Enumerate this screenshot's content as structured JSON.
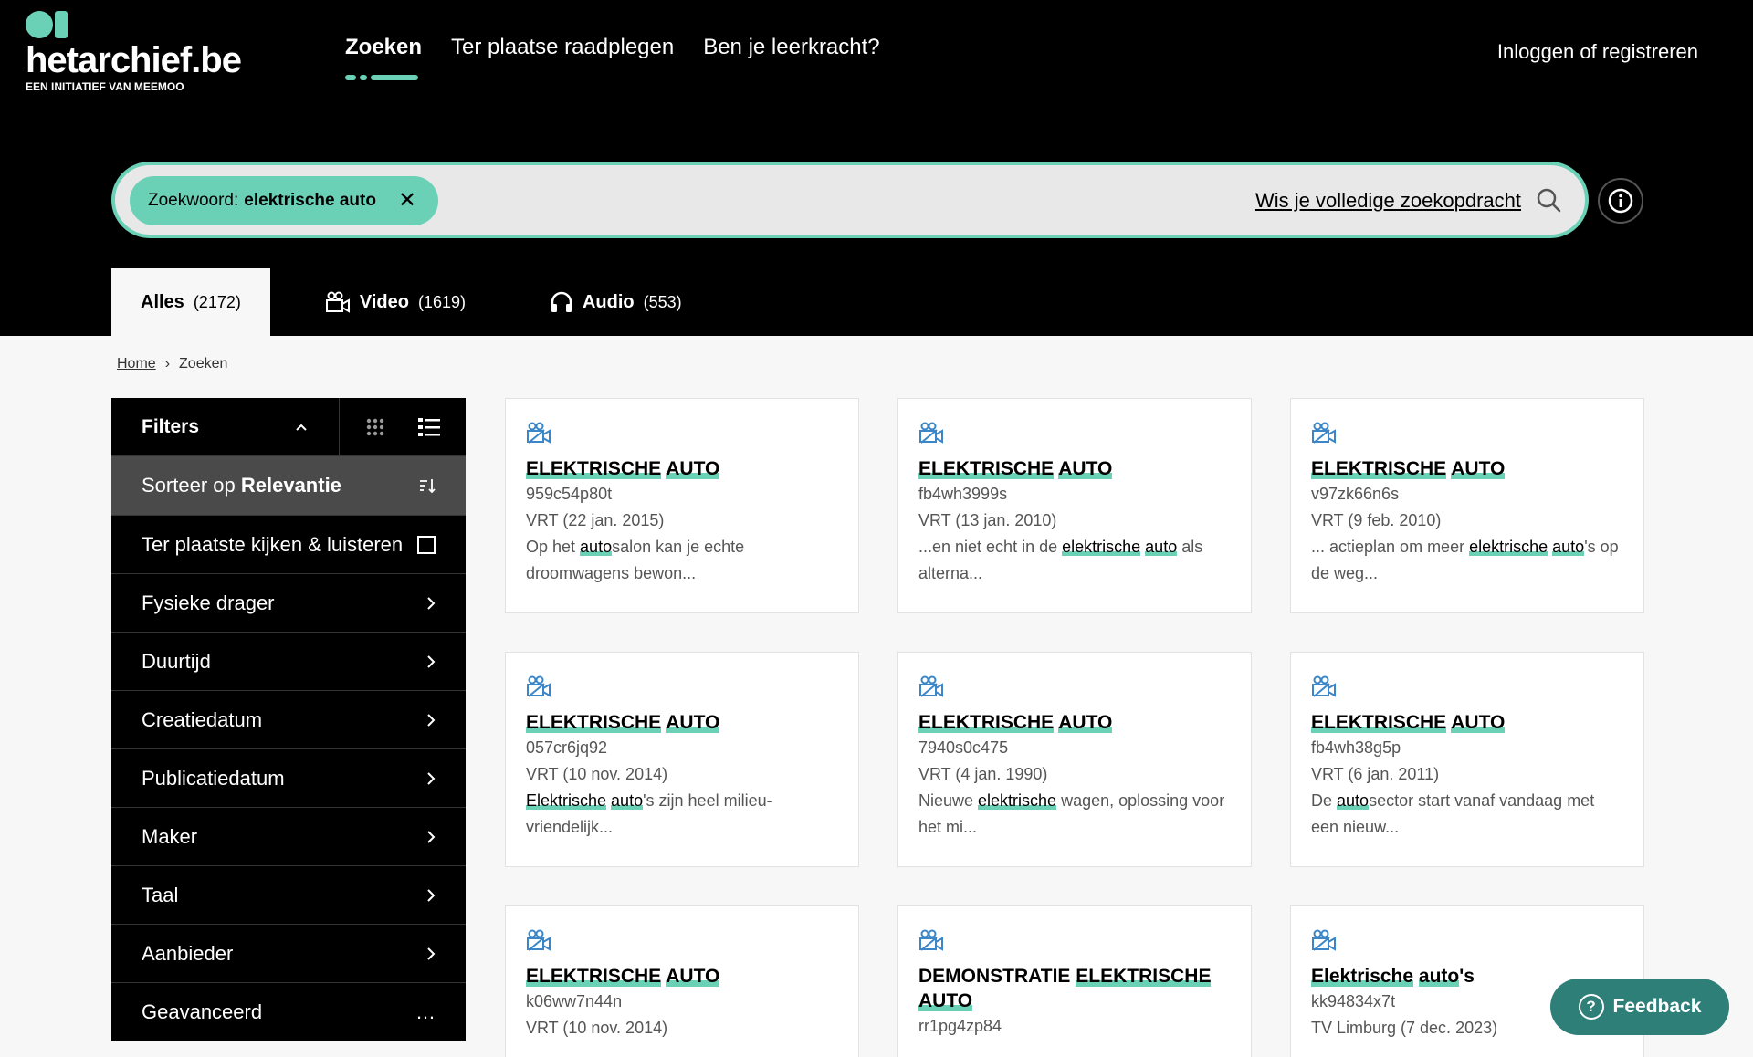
{
  "brand": {
    "wordmark": "hetarchief.be",
    "tagline": "EEN INITIATIEF VAN MEEMOO",
    "accent": "#6ad0b6"
  },
  "nav": {
    "items": [
      "Zoeken",
      "Ter plaatse raadplegen",
      "Ben je leerkracht?"
    ],
    "login": "Inloggen of registreren"
  },
  "search": {
    "chip_label": "Zoekwoord:",
    "chip_value": "elektrische auto",
    "clear": "Wis je volledige zoekopdracht",
    "icons": {
      "search": "search-icon",
      "info": "info-icon",
      "remove": "close-icon"
    }
  },
  "tabs": [
    {
      "label": "Alles",
      "count": "(2172)",
      "icon": ""
    },
    {
      "label": "Video",
      "count": "(1619)",
      "icon": "video-camera-icon"
    },
    {
      "label": "Audio",
      "count": "(553)",
      "icon": "headphones-icon"
    }
  ],
  "breadcrumb": {
    "home": "Home",
    "current": "Zoeken"
  },
  "sidebar": {
    "filters": "Filters",
    "sort_prefix": "Sorteer op",
    "sort_value": "Relevantie",
    "onsite": "Ter plaatste kijken & luisteren",
    "items": [
      "Fysieke drager",
      "Duurtijd",
      "Creatiedatum",
      "Publicatiedatum",
      "Maker",
      "Taal",
      "Aanbieder"
    ],
    "advanced": "Geavanceerd",
    "advanced_icon": "…"
  },
  "cards": [
    {
      "title": [
        [
          "ELEKTRISCHE",
          true
        ],
        [
          " ",
          false
        ],
        [
          "AUTO",
          true
        ]
      ],
      "id": "959c54p80t",
      "meta": "VRT (22 jan. 2015)",
      "desc": [
        [
          "Op het ",
          false
        ],
        [
          "auto",
          true
        ],
        [
          "salon kan je echte droomwagens bewon...",
          false
        ]
      ]
    },
    {
      "title": [
        [
          "ELEKTRISCHE",
          true
        ],
        [
          " ",
          false
        ],
        [
          "AUTO",
          true
        ]
      ],
      "id": "fb4wh3999s",
      "meta": "VRT (13 jan. 2010)",
      "desc": [
        [
          "...en niet echt in de ",
          false
        ],
        [
          "elektrische",
          true
        ],
        [
          " ",
          false
        ],
        [
          "auto",
          true
        ],
        [
          " als alterna...",
          false
        ]
      ]
    },
    {
      "title": [
        [
          "ELEKTRISCHE",
          true
        ],
        [
          " ",
          false
        ],
        [
          "AUTO",
          true
        ]
      ],
      "id": "v97zk66n6s",
      "meta": "VRT (9 feb. 2010)",
      "desc": [
        [
          "... actieplan om meer ",
          false
        ],
        [
          "elektrische",
          true
        ],
        [
          " ",
          false
        ],
        [
          "auto",
          true
        ],
        [
          "'s op de weg...",
          false
        ]
      ]
    },
    {
      "title": [
        [
          "ELEKTRISCHE",
          true
        ],
        [
          " ",
          false
        ],
        [
          "AUTO",
          true
        ]
      ],
      "id": "057cr6jq92",
      "meta": "VRT (10 nov. 2014)",
      "desc": [
        [
          "Elektrische",
          true
        ],
        [
          " ",
          false
        ],
        [
          "auto",
          true
        ],
        [
          "'s zijn heel milieu-vriendelijk...",
          false
        ]
      ]
    },
    {
      "title": [
        [
          "ELEKTRISCHE",
          true
        ],
        [
          " ",
          false
        ],
        [
          "AUTO",
          true
        ]
      ],
      "id": "7940s0c475",
      "meta": "VRT (4 jan. 1990)",
      "desc": [
        [
          "Nieuwe ",
          false
        ],
        [
          "elektrische",
          true
        ],
        [
          " wagen, oplossing voor het mi...",
          false
        ]
      ]
    },
    {
      "title": [
        [
          "ELEKTRISCHE",
          true
        ],
        [
          " ",
          false
        ],
        [
          "AUTO",
          true
        ]
      ],
      "id": "fb4wh38g5p",
      "meta": "VRT (6 jan. 2011)",
      "desc": [
        [
          "De ",
          false
        ],
        [
          "auto",
          true
        ],
        [
          "sector start vanaf vandaag met een nieuw...",
          false
        ]
      ]
    },
    {
      "title": [
        [
          "ELEKTRISCHE",
          true
        ],
        [
          " ",
          false
        ],
        [
          "AUTO",
          true
        ]
      ],
      "id": "k06ww7n44n",
      "meta": "VRT (10 nov. 2014)",
      "desc": []
    },
    {
      "title": [
        [
          "DEMONSTRATIE",
          false
        ],
        [
          " ",
          false
        ],
        [
          "ELEKTRISCHE",
          true
        ],
        [
          " ",
          false
        ],
        [
          "AUTO",
          true
        ]
      ],
      "id": "rr1pg4zp84",
      "meta": "",
      "desc": []
    },
    {
      "title": [
        [
          "Elektrische",
          true
        ],
        [
          " ",
          false
        ],
        [
          "auto",
          true
        ],
        [
          "'s",
          false
        ]
      ],
      "id": "kk94834x7t",
      "meta": "TV Limburg (7 dec. 2023)",
      "desc": [],
      "plain": true
    }
  ],
  "feedback": "Feedback"
}
